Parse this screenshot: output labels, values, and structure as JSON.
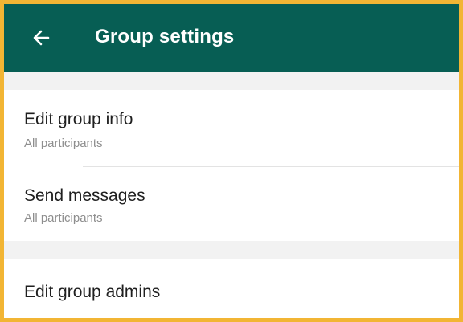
{
  "header": {
    "title": "Group settings",
    "back_icon": "arrow-left-icon",
    "background_color": "#075e54"
  },
  "settings": {
    "items": [
      {
        "label": "Edit group info",
        "sublabel": "All participants"
      },
      {
        "label": "Send messages",
        "sublabel": "All participants"
      },
      {
        "label": "Edit group admins"
      }
    ]
  },
  "colors": {
    "frame_border": "#f2b534",
    "section_gap": "#f2f2f2"
  }
}
